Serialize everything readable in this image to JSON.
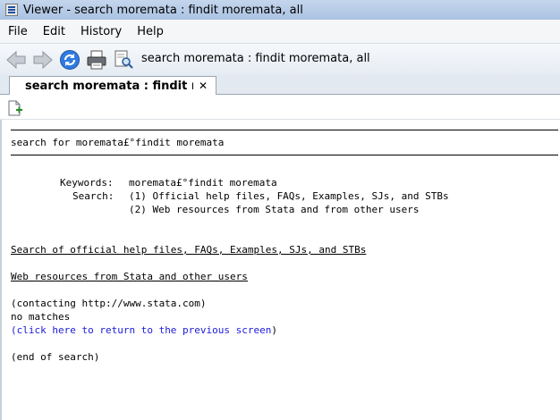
{
  "window": {
    "title": "Viewer - search moremata : findit moremata, all"
  },
  "menu": {
    "items": [
      "File",
      "Edit",
      "History",
      "Help"
    ]
  },
  "toolbar": {
    "address": "search moremata : findit moremata, all",
    "icons": [
      "back-arrow-icon",
      "forward-arrow-icon",
      "refresh-icon",
      "print-icon",
      "find-icon"
    ]
  },
  "tab": {
    "label": "search moremata : findit mor...",
    "close": "✕"
  },
  "content": {
    "header": "search for moremata£°findit moremata",
    "keywords_label": "Keywords:",
    "keywords_value": "moremata£°findit moremata",
    "search_label": "Search:",
    "search_1": "(1) Official help files, FAQs, Examples, SJs, and STBs",
    "search_2": "(2) Web resources from Stata and from other users",
    "section_official": "Search of official help files, FAQs, Examples, SJs, and STBs",
    "section_web": "Web resources from Stata and other users",
    "contacting": "(contacting http://www.stata.com)",
    "no_matches": "no matches",
    "return_open": "(",
    "return_link": "click here to return to the previous screen",
    "return_close": ")",
    "end": "(end of search)"
  },
  "colors": {
    "link": "#1a1adb",
    "titlebar": "#aac2e2"
  }
}
